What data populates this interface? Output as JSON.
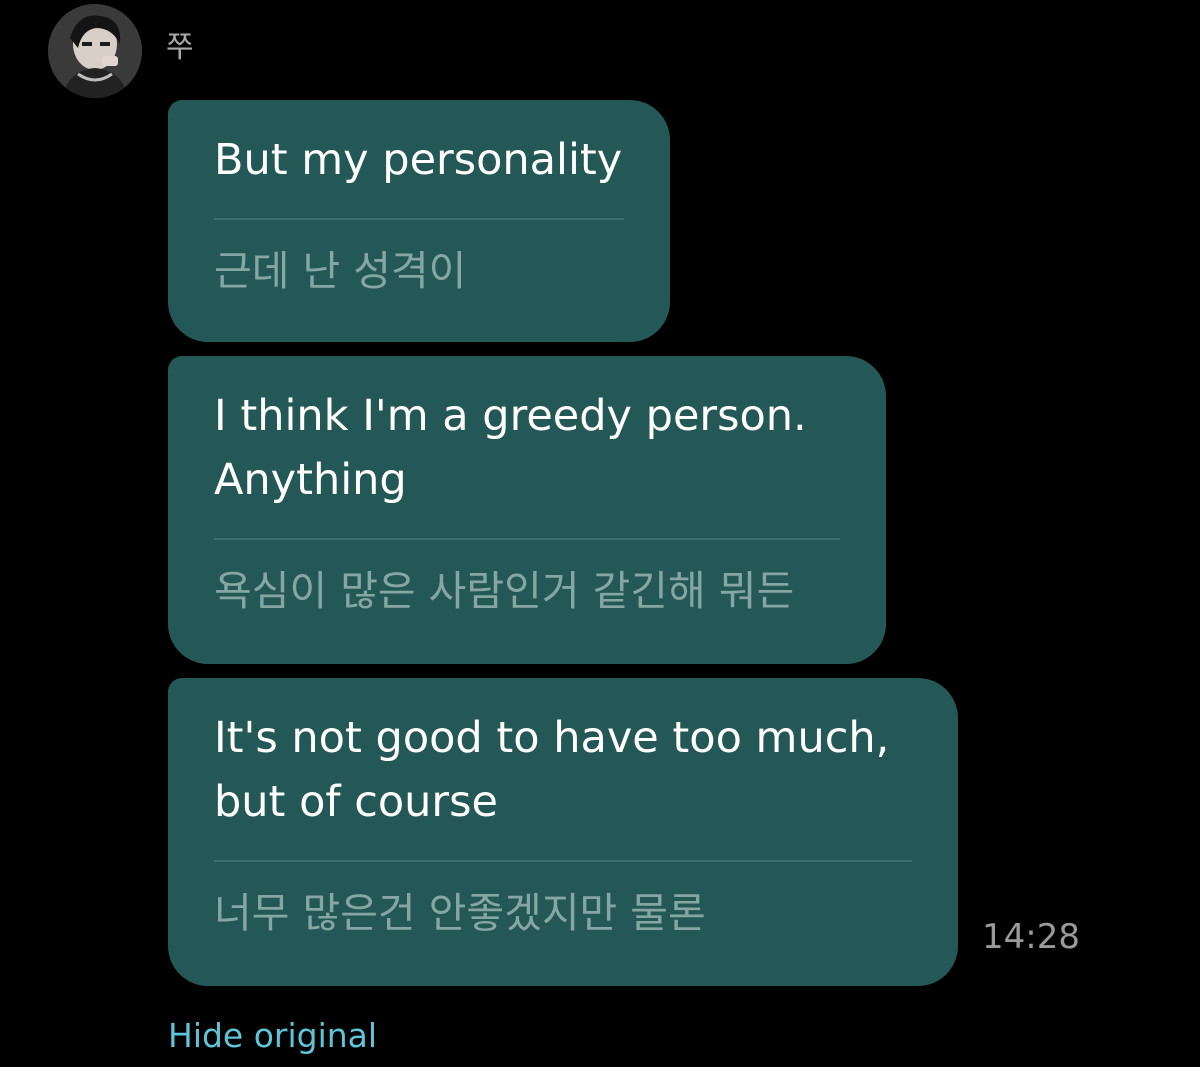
{
  "sender": {
    "name": "쭈",
    "avatar": "profile-photo"
  },
  "messages": [
    {
      "translated": "But my personality",
      "original": "근데 난 성격이"
    },
    {
      "translated": "I think I'm a greedy person.\nAnything",
      "original": "욕심이 많은 사람인거 같긴해 뭐든"
    },
    {
      "translated": "It's not good to have too much,\nbut of course",
      "original": "너무 많은건 안좋겠지만 물론"
    }
  ],
  "timestamp": "14:28",
  "hide_original_label": "Hide original",
  "colors": {
    "background": "#000000",
    "bubble": "#245856",
    "translated_text": "#ffffff",
    "original_text": "#86a6a4",
    "link": "#5ec4d8"
  }
}
